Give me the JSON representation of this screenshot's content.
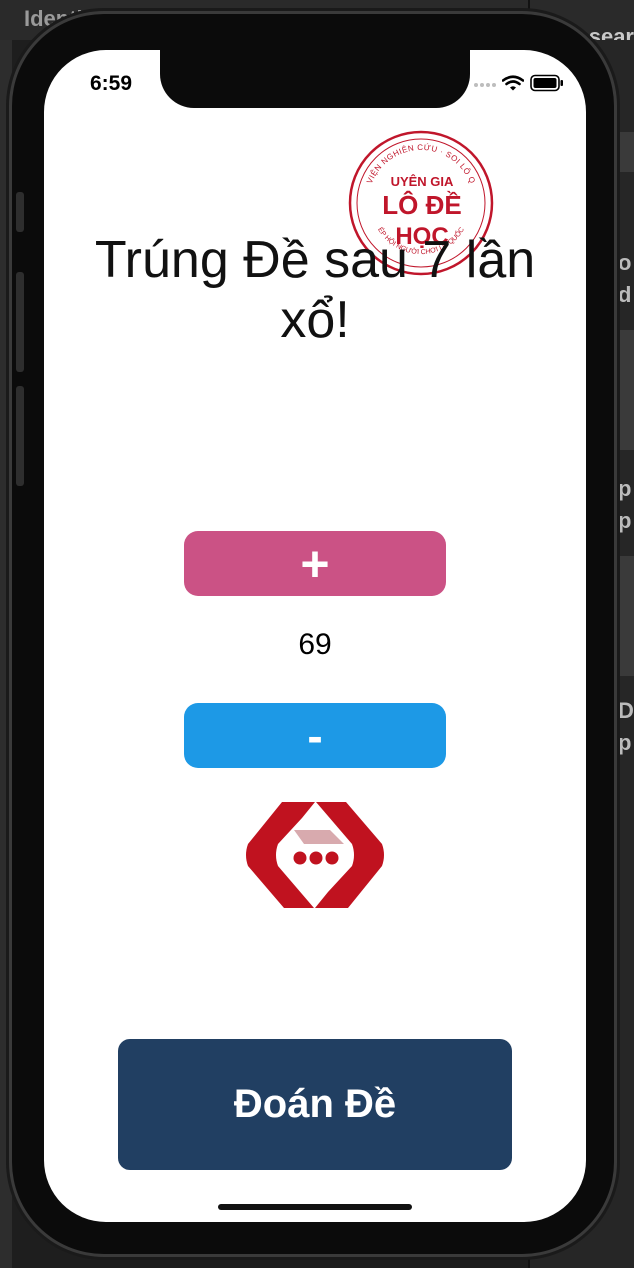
{
  "background": {
    "title": "Identity and T",
    "right_title": "sear",
    "right_fragments": [
      "o",
      "d",
      "p",
      "p",
      "D",
      "p"
    ]
  },
  "status_bar": {
    "time": "6:59"
  },
  "stamp": {
    "top_text": "VIỆN NGHIÊN CỨU · SOI LÔ Q",
    "line1": "UYÊN GIA",
    "line2": "LÔ ĐỀ",
    "line3": "HỌC",
    "bottom_text": "ÉP HỘI NGƯỜI CHƠI LÔ QUỐC"
  },
  "headline": "Trúng Đề sau 7 lần xổ!",
  "increment_label": "+",
  "counter_value": "69",
  "decrement_label": "-",
  "guess_button_label": "Đoán Đề",
  "colors": {
    "plus_button": "#cb5285",
    "minus_button": "#1d99e6",
    "guess_button": "#213f62",
    "logo_red": "#c0121f"
  }
}
